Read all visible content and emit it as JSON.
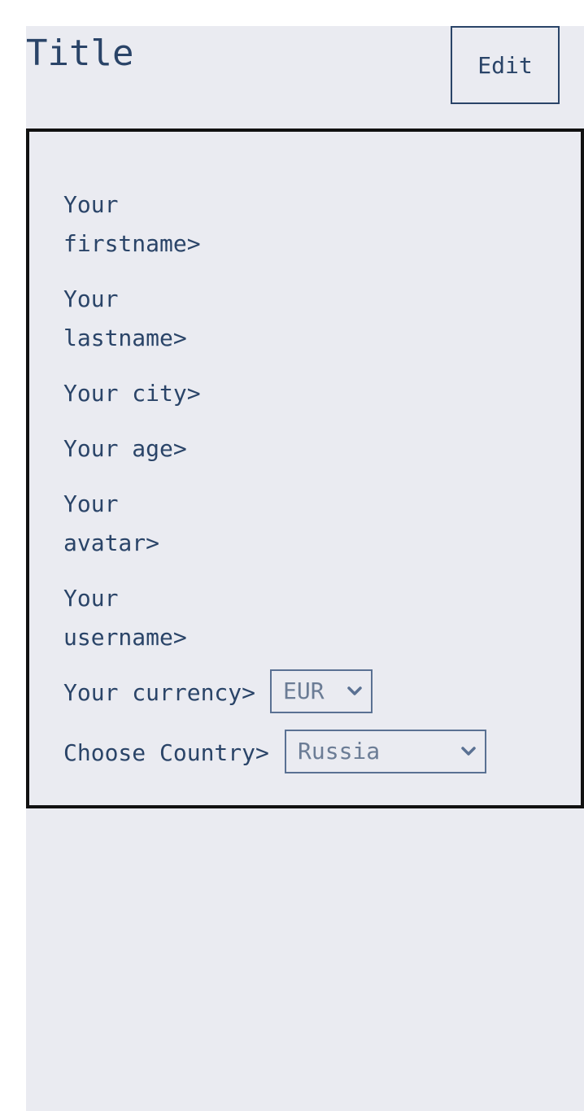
{
  "header": {
    "title": "Title",
    "edit_label": "Edit"
  },
  "form": {
    "firstname_label": "Your\nfirstname>",
    "lastname_label": "Your\nlastname>",
    "city_label": "Your city>",
    "age_label": "Your age>",
    "avatar_label": "Your\navatar>",
    "username_label": "Your\nusername>",
    "currency_label": "Your currency>",
    "currency_value": "EUR",
    "country_label": "Choose Country>",
    "country_value": "Russia"
  },
  "icons": {
    "dropdown": "chevron-down-icon"
  },
  "colors": {
    "background": "#eaebf1",
    "text": "#2a4468",
    "border": "#111111",
    "select_text": "#6b7c95"
  }
}
